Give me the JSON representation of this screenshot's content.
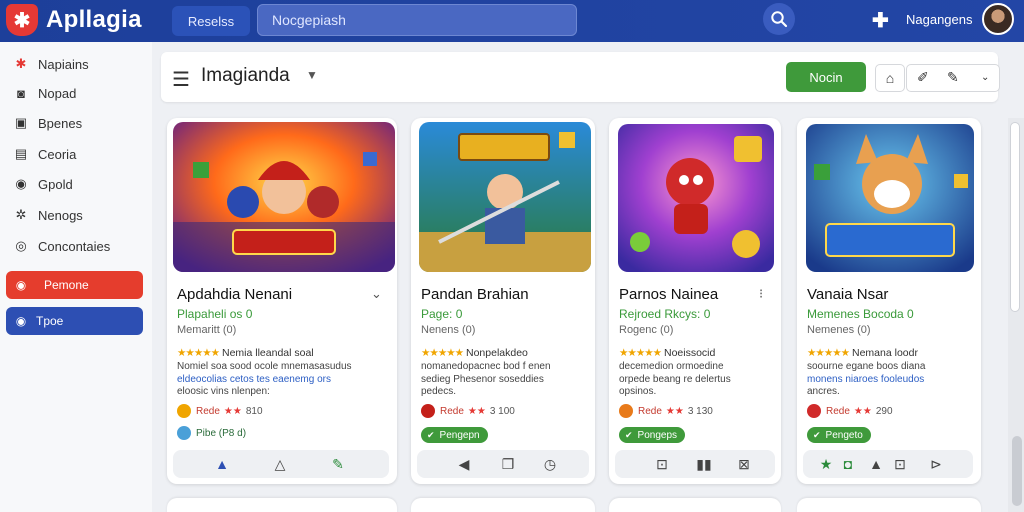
{
  "app": {
    "title": "Apllagia",
    "logo_glyph": "✱"
  },
  "topbar": {
    "tab_label": "Reselss",
    "search_placeholder": "Nocgepiash",
    "user_name": "Nagangens",
    "search_icon": "search-icon",
    "plus_icon": "plus-icon"
  },
  "sidebar": {
    "items": [
      {
        "label": "Napiains",
        "icon": "✱"
      },
      {
        "label": "Nopad",
        "icon": "◙"
      },
      {
        "label": "Bpenes",
        "icon": "▣"
      },
      {
        "label": "Ceoria",
        "icon": "▤"
      },
      {
        "label": "Gpold",
        "icon": "◉"
      },
      {
        "label": "Nenogs",
        "icon": "✲"
      },
      {
        "label": "Concontaies",
        "icon": "◎"
      }
    ],
    "buttons": [
      {
        "label": "Pemone",
        "icon": "◉",
        "color": "#e53d2d"
      },
      {
        "label": "Tpoe",
        "icon": "◉",
        "color": "#2d4fb3"
      }
    ]
  },
  "header": {
    "title": "Imagianda",
    "primary_button": "Nocin"
  },
  "cards": [
    {
      "name": "Apdahdia Nenani",
      "price": "Plapaheli os 0",
      "developer": "Memaritt (0)",
      "rating_text": "Nemia lleandal soal",
      "description": [
        "Nomiel soa sood  ocole mnemasasudus",
        "eldeocolias  cetos tes eaenemg ors",
        "eloosic vins nlenpen:"
      ],
      "highlight": "cetos tes eaenemg ors",
      "review_name": "Rede",
      "review_num": "810",
      "sub_label": "Pibe (P8 d)",
      "tag": null
    },
    {
      "name": "Pandan Brahian",
      "price": "Page: 0",
      "developer": "Nenens (0)",
      "rating_text": "Nonpelakdeo",
      "description": [
        "nomanedopacnec bod f enen",
        "sedieg Phesenor soseddies",
        "pedecs."
      ],
      "highlight": "",
      "review_name": "Rede",
      "review_num": "3 100",
      "sub_label": "",
      "tag": "Pengepn"
    },
    {
      "name": "Parnos Nainea",
      "price": "Rejroed Rkcys: 0",
      "developer": "Rogenc (0)",
      "rating_text": "Noeissocid",
      "description": [
        "decemedion ormoedine",
        "orpede beang re delertus",
        "opsinos."
      ],
      "highlight": "",
      "review_name": "Rede",
      "review_num": "3 130",
      "sub_label": "",
      "tag": "Pongeps"
    },
    {
      "name": "Vanaia Nsar",
      "price": "Memenes Bocoda 0",
      "developer": "Nemenes (0)",
      "rating_text": "Nemana loodr",
      "description": [
        "soourne egane boos diana",
        "monens niaroes fooleudos",
        "ancres."
      ],
      "highlight": "fooleudos",
      "review_name": "Rede",
      "review_num": "290",
      "sub_label": "",
      "tag": "Pengeto"
    }
  ],
  "colors": {
    "topbar": "#1d3f9a",
    "accent_green": "#3f9a3b",
    "accent_red": "#e53d2d",
    "accent_blue": "#2d4fb3"
  }
}
